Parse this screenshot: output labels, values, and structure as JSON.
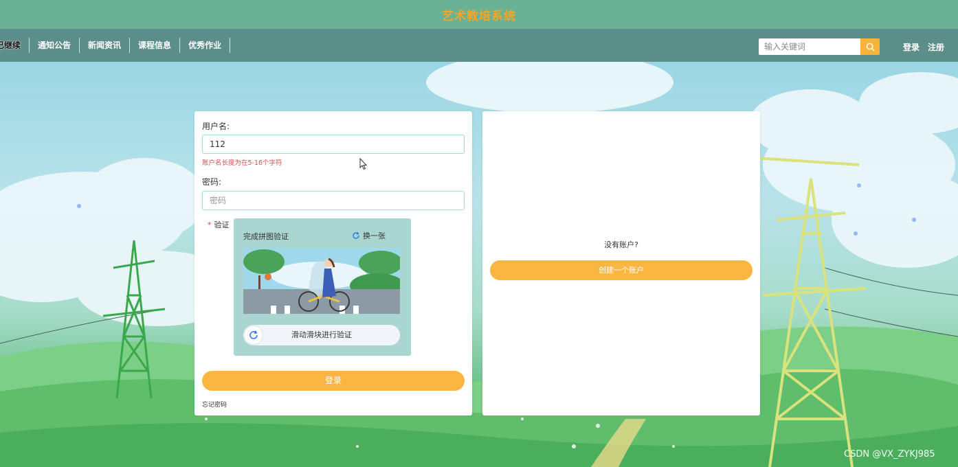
{
  "header": {
    "title": "艺术教培系统"
  },
  "nav": {
    "items": [
      {
        "label": "已继续"
      },
      {
        "label": "通知公告"
      },
      {
        "label": "新闻资讯"
      },
      {
        "label": "课程信息"
      },
      {
        "label": "优秀作业"
      }
    ],
    "search": {
      "placeholder": "输入关键词",
      "icon": "search-icon"
    },
    "auth": {
      "login": "登录",
      "register": "注册"
    }
  },
  "login": {
    "username_label": "用户名:",
    "username_value": "112",
    "username_error": "账户名长度为在5-16个字符",
    "password_label": "密码:",
    "password_placeholder": "密码",
    "captcha_label": "验证",
    "captcha_required_mark": "*",
    "captcha_title": "完成拼图验证",
    "captcha_refresh": "换一张",
    "slider_text": "滑动滑块进行验证",
    "submit": "登录",
    "forgot": "忘记密码"
  },
  "register": {
    "prompt": "没有账户?",
    "create": "创建一个账户"
  },
  "watermark": "CSDN @VX_ZYKJ985",
  "colors": {
    "title_bar": "#6bb196",
    "nav_bar": "#5b8d89",
    "accent": "#fbb642",
    "title_text": "#f5a623",
    "error": "#e5474b"
  }
}
